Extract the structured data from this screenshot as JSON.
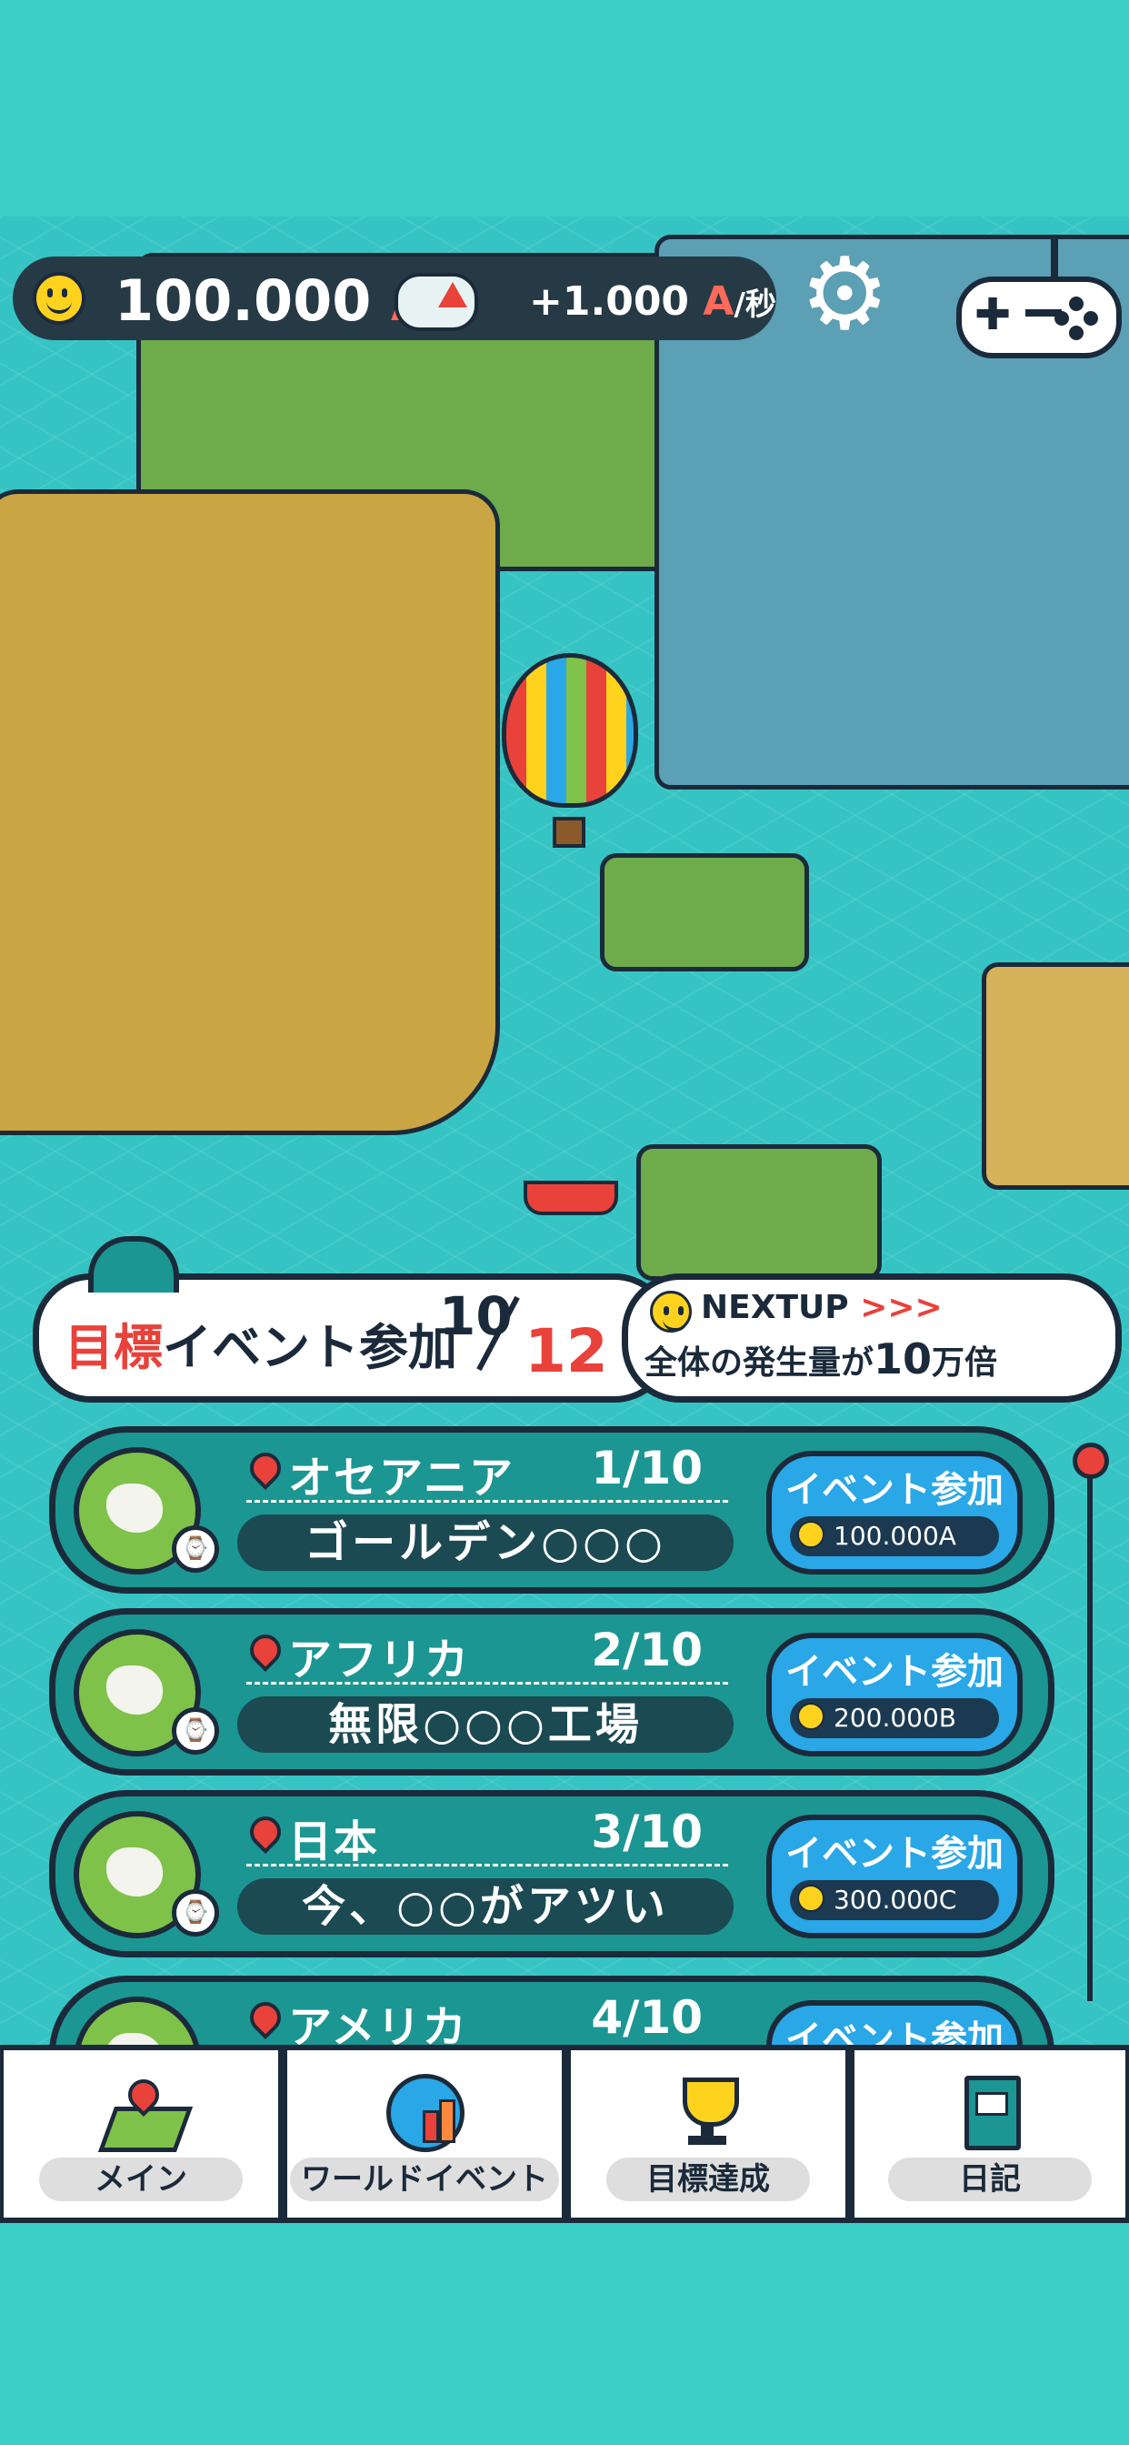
{
  "resources": {
    "amount": "100.000",
    "amount_unit": "A",
    "rate": "+1.000",
    "rate_unit": "A",
    "rate_per": "/秒"
  },
  "goal": {
    "label_prefix": "目標",
    "label_main": "イベント参加",
    "current": "10",
    "total": "12"
  },
  "nextup": {
    "label": "NEXTUP",
    "arrows": ">>>",
    "desc_pre": "全体の発生量が",
    "desc_num": "10",
    "desc_post": "万倍"
  },
  "events": [
    {
      "region": "オセアニア",
      "progress": "1/10",
      "title": "ゴールデン○○○",
      "button": "イベント参加",
      "cost": "100.000A"
    },
    {
      "region": "アフリカ",
      "progress": "2/10",
      "title": "無限○○○工場",
      "button": "イベント参加",
      "cost": "200.000B"
    },
    {
      "region": "日本",
      "progress": "3/10",
      "title": "今、○○がアツい",
      "button": "イベント参加",
      "cost": "300.000C"
    },
    {
      "region": "アメリカ",
      "progress": "4/10",
      "title": "",
      "button": "イベント参加",
      "cost": ""
    }
  ],
  "nav": {
    "main": "メイン",
    "world_event": "ワールドイベント",
    "goal": "目標達成",
    "diary": "日記"
  },
  "icons": [
    "smiley-icon",
    "rate-boost-icon",
    "gear-icon",
    "gamepad-icon",
    "pin-icon",
    "tv-icon",
    "map-icon",
    "chart-globe-icon",
    "trophy-icon",
    "book-icon"
  ],
  "colors": {
    "background": "#3ccfc8",
    "card": "#1c9692",
    "button": "#29a7e6",
    "accent": "#e8423b",
    "outline": "#1b2a3a"
  }
}
